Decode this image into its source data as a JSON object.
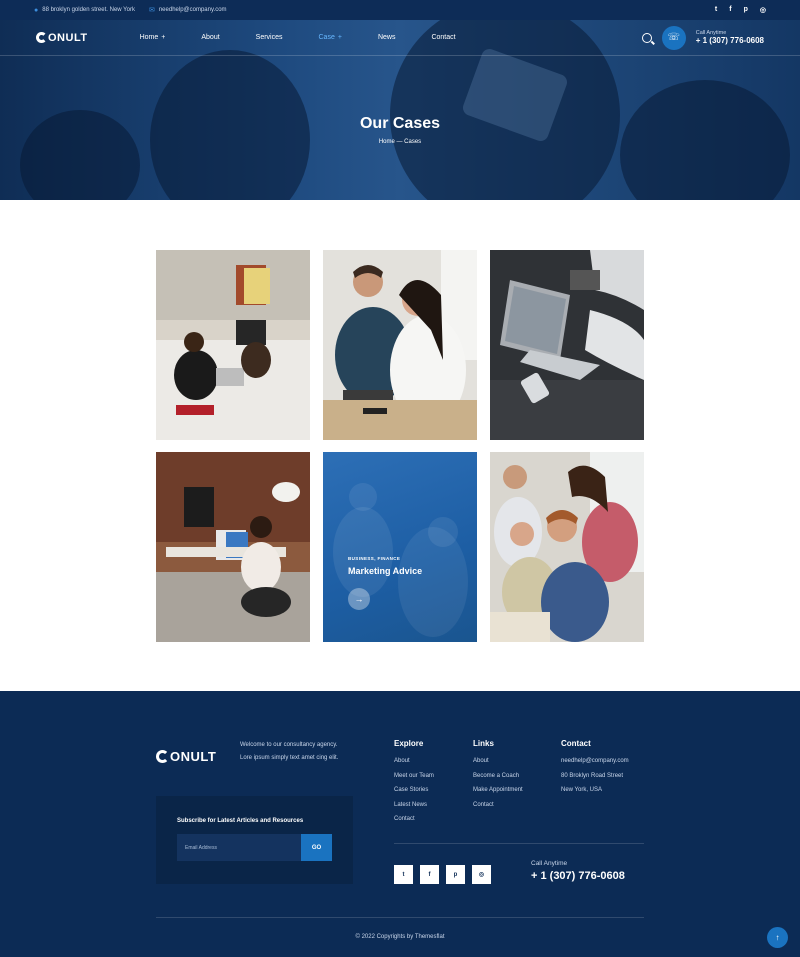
{
  "topbar": {
    "address": "88 broklyn golden street. New York",
    "email": "needhelp@company.com",
    "socials": [
      {
        "icon": "twitter-icon",
        "glyph": "t"
      },
      {
        "icon": "facebook-icon",
        "glyph": "f"
      },
      {
        "icon": "pinterest-icon",
        "glyph": "p"
      },
      {
        "icon": "instagram-icon",
        "glyph": "◎"
      }
    ]
  },
  "nav": {
    "logo": "ONULT",
    "items": [
      {
        "label": "Home",
        "caret": "+",
        "active": false
      },
      {
        "label": "About",
        "caret": "",
        "active": false
      },
      {
        "label": "Services",
        "caret": "",
        "active": false
      },
      {
        "label": "Case",
        "caret": "+",
        "active": true
      },
      {
        "label": "News",
        "caret": "",
        "active": false
      },
      {
        "label": "Contact",
        "caret": "",
        "active": false
      }
    ],
    "call_label": "Call Anytime",
    "call_number": "+ 1 (307) 776-0608"
  },
  "hero": {
    "title": "Our Cases",
    "breadcrumb_home": "Home",
    "breadcrumb_separator": "—",
    "breadcrumb_current": "Cases"
  },
  "cases": {
    "featured": {
      "tag": "BUSINESS, FINANCE",
      "title": "Marketing Advice",
      "arrow": "→"
    }
  },
  "footer": {
    "logo": "ONULT",
    "about": "Welcome to our consultancy agency. Lore ipsum simply text amet cing elit.",
    "subscribe_heading": "Subscribe for Latest Articles and Resources",
    "email_placeholder": "Email Address",
    "go_label": "GO",
    "explore": {
      "heading": "Explore",
      "items": [
        "About",
        "Meet our Team",
        "Case Stories",
        "Latest News",
        "Contact"
      ]
    },
    "links": {
      "heading": "Links",
      "items": [
        "About",
        "Become a Coach",
        "Make Appointment",
        "Contact"
      ]
    },
    "contact": {
      "heading": "Contact",
      "items": [
        "needhelp@company.com",
        "80 Broklyn Road Street",
        "New York, USA"
      ]
    },
    "call_label": "Call Anytime",
    "call_number": "+ 1 (307) 776-0608",
    "copyright": "© 2022 Copyrights by Themesflat",
    "totop": "↑"
  },
  "colors": {
    "primary": "#1a73c0",
    "navy": "#0c2b55",
    "accent_link": "#67b7ff"
  }
}
